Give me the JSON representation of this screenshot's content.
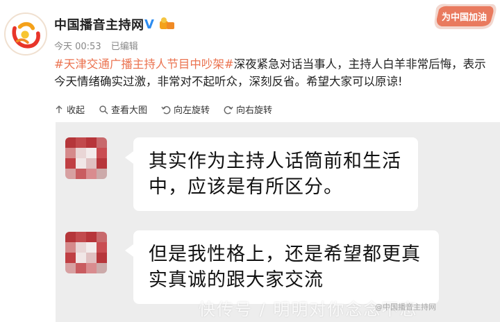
{
  "header": {
    "account_name": "中国播音主持网",
    "time": "今天 00:53",
    "edited": "已编辑",
    "promo_text": "为中国加油"
  },
  "post": {
    "hashtag": "#天津交通广播主持人节目中吵架#",
    "body": "深夜紧急对话当事人，主持人白羊非常后悔，表示今天情绪确实过激，非常对不起听众，深刻反省。希望大家可以原谅!"
  },
  "actions": {
    "collapse": "收起",
    "view_large": "查看大图",
    "rotate_left": "向左旋转",
    "rotate_right": "向右旋转"
  },
  "chat": {
    "messages": [
      {
        "text": "其实作为主持人话筒前和生活中，应该是有所区分。"
      },
      {
        "text": "但是我性格上，还是希望都更真实真诚的跟大家交流"
      }
    ]
  },
  "watermark": {
    "text": "快传号 / 明明对你念念不忘",
    "sub": "@中国播音主持网"
  },
  "colors": {
    "hashtag": "#eb7350",
    "chat_bg": "#ededed",
    "bubble_bg": "#ffffff"
  }
}
